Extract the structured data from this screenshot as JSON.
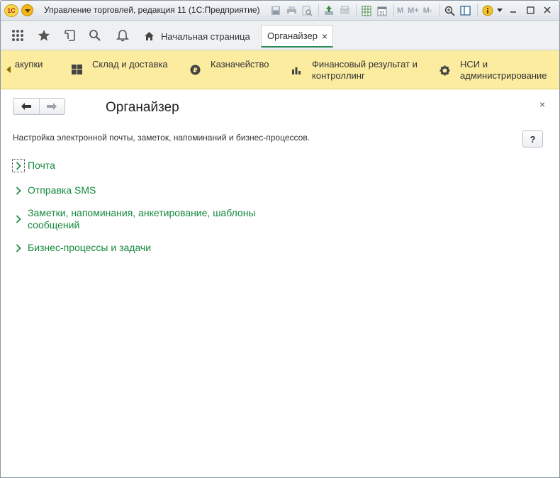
{
  "window": {
    "title": "Управление торговлей, редакция 11  (1С:Предприятие)",
    "logo_text": "1С",
    "toolbar_m": [
      "M",
      "M+",
      "M-"
    ]
  },
  "tabs": [
    {
      "label": "Начальная страница",
      "icon": "home-icon"
    },
    {
      "label": "Органайзер",
      "close": "×"
    }
  ],
  "sections": [
    {
      "label": "Закупки"
    },
    {
      "label": "Склад и доставка",
      "icon": "grid-icon"
    },
    {
      "label": "Казначейство",
      "icon": "ruble-icon"
    },
    {
      "label": "Финансовый результат и контроллинг",
      "icon": "bar-chart-icon"
    },
    {
      "label": "НСИ и администрирование",
      "icon": "gear-icon"
    }
  ],
  "page": {
    "title": "Органайзер",
    "description": "Настройка электронной почты, заметок, напоминаний и бизнес-процессов.",
    "help_label": "?",
    "close_label": "×"
  },
  "groups": [
    {
      "label": "Почта"
    },
    {
      "label": "Отправка SMS"
    },
    {
      "label": "Заметки, напоминания, анкетирование, шаблоны сообщений"
    },
    {
      "label": "Бизнес-процессы и задачи"
    }
  ],
  "colors": {
    "accent_green": "#14883d",
    "section_bg": "#fbeca0",
    "titlebar_bg": "#dfe4ea"
  }
}
